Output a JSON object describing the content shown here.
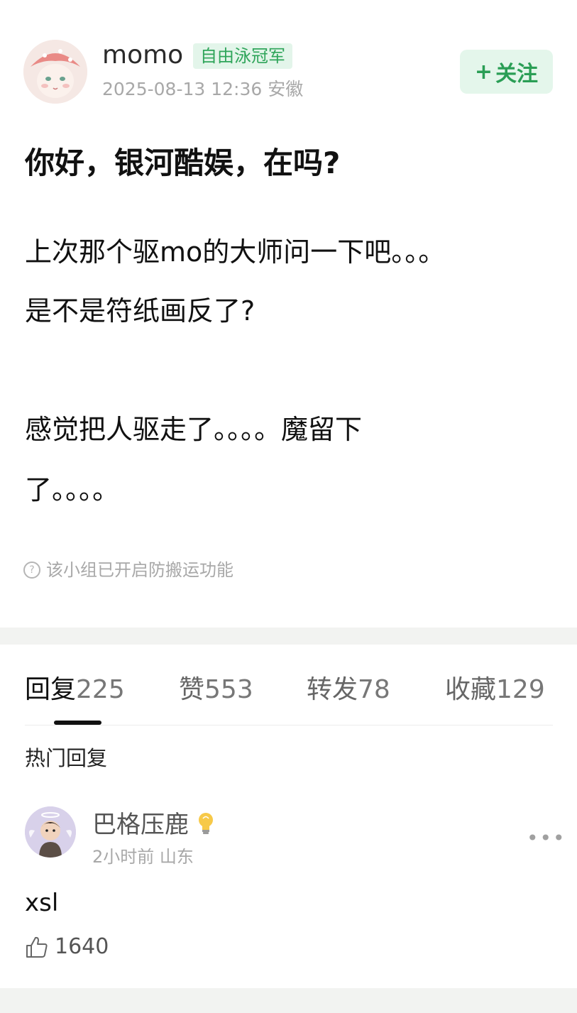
{
  "post": {
    "author": "momo",
    "author_badge": "自由泳冠军",
    "meta": "2025-08-13 12:36 安徽",
    "follow_label": "关注",
    "follow_plus": "+",
    "title": "你好，银河酷娱，在吗?",
    "body_lines": [
      "上次那个驱mo的大师问一下吧。。。",
      "是不是符纸画反了?",
      "感觉把人驱走了。。。。魔留下",
      "了。。。。"
    ],
    "notice": "该小组已开启防搬运功能",
    "notice_icon": "?"
  },
  "stats_tabs": [
    {
      "label": "回复",
      "count": "225",
      "active": true
    },
    {
      "label": "赞",
      "count": "553",
      "active": false
    },
    {
      "label": "转发",
      "count": "78",
      "active": false
    },
    {
      "label": "收藏",
      "count": "129",
      "active": false
    }
  ],
  "hot_replies_heading": "热门回复",
  "comment": {
    "author": "巴格压鹿",
    "author_badge_icon": "lightbulb-icon",
    "meta": "2小时前 山东",
    "text": "xsl",
    "likes": "1640",
    "more_label": "•••"
  },
  "colors": {
    "accent_green": "#2fa55a",
    "badge_bg": "#e3f5ea",
    "meta_gray": "#a8a8a8"
  }
}
